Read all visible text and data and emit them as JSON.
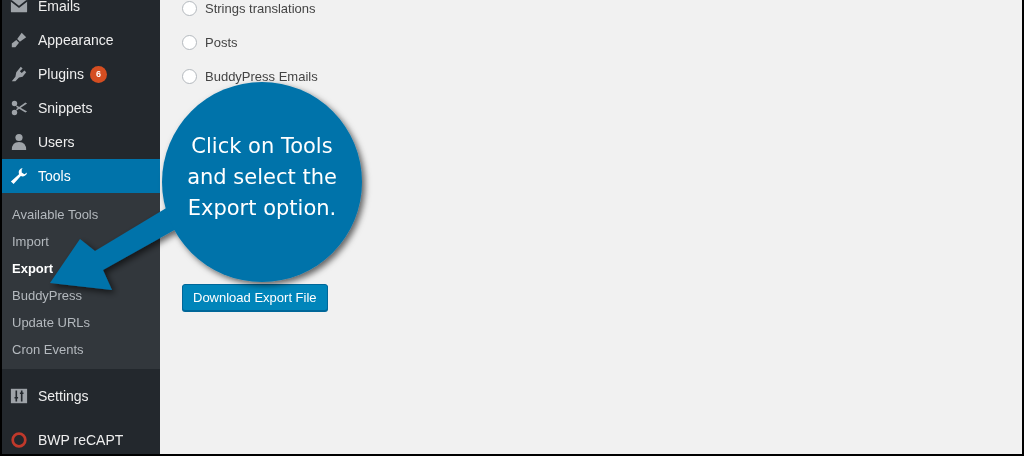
{
  "sidebar": {
    "items": [
      {
        "label": "Emails",
        "selected": false
      },
      {
        "label": "Appearance",
        "selected": false
      },
      {
        "label": "Plugins",
        "selected": false,
        "badge": "6"
      },
      {
        "label": "Snippets",
        "selected": false
      },
      {
        "label": "Users",
        "selected": false
      },
      {
        "label": "Tools",
        "selected": true,
        "children": [
          {
            "label": "Available Tools",
            "selected": false
          },
          {
            "label": "Import",
            "selected": false
          },
          {
            "label": "Export",
            "selected": true
          },
          {
            "label": "BuddyPress",
            "selected": false
          },
          {
            "label": "Update URLs",
            "selected": false
          },
          {
            "label": "Cron Events",
            "selected": false
          }
        ]
      },
      {
        "label": "Settings",
        "selected": false
      },
      {
        "label": "BWP reCAPT",
        "selected": false
      }
    ]
  },
  "export_options": [
    {
      "label": "Strings translations",
      "selected": false
    },
    {
      "label": "Posts",
      "selected": false
    },
    {
      "label": "BuddyPress Emails",
      "selected": false
    }
  ],
  "download_button": "Download Export File",
  "callout": {
    "lines": [
      "Click on Tools",
      "and select the",
      "Export option."
    ]
  }
}
